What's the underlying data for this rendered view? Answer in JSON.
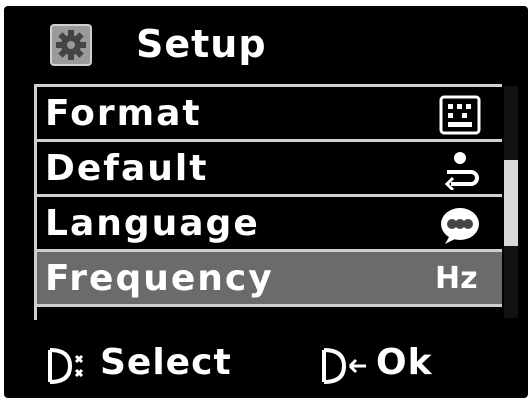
{
  "header": {
    "title": "Setup",
    "icon": "gear-icon"
  },
  "menu": {
    "items": [
      {
        "label": "Format",
        "icon": "format-grid-icon",
        "selected": false
      },
      {
        "label": "Default",
        "icon": "reset-default-icon",
        "selected": false
      },
      {
        "label": "Language",
        "icon": "abc-language-icon",
        "selected": false
      },
      {
        "label": "Frequency",
        "icon": "hz-icon",
        "icon_text": "Hz",
        "selected": true
      }
    ]
  },
  "footer": {
    "select_label": "Select",
    "ok_label": "Ok"
  },
  "colors": {
    "background": "#000000",
    "text": "#ffffff",
    "selected_row": "#6b6b6b",
    "border": "#cfcfcf"
  }
}
